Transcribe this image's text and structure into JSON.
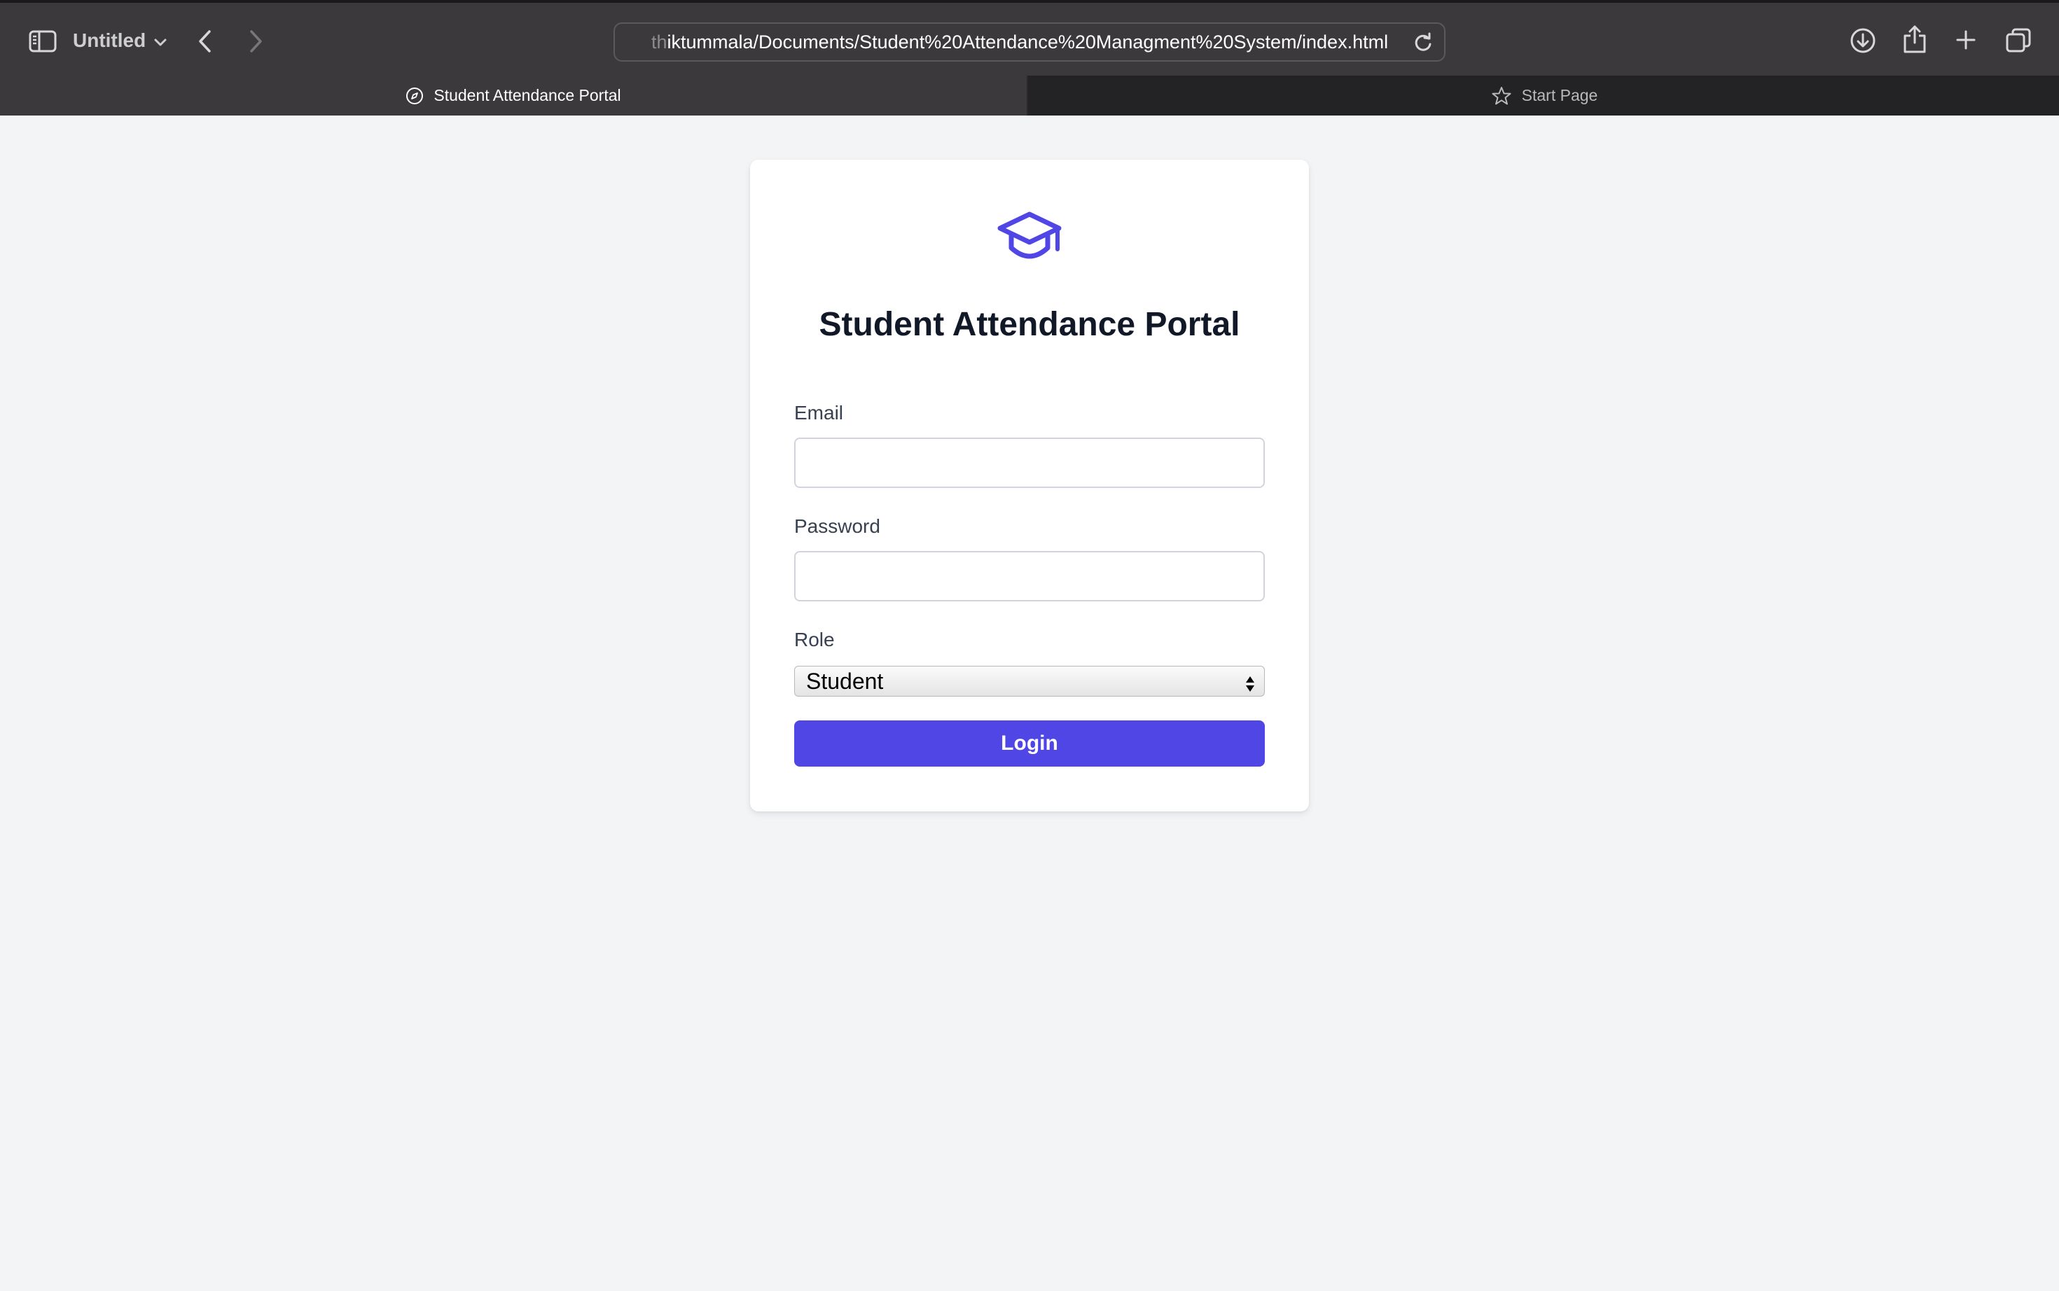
{
  "browser": {
    "window_title": "Untitled",
    "url_prefix_faded": "th",
    "url_main": "iktummala/Documents/Student%20Attendance%20Managment%20System/index.html",
    "tabs": [
      {
        "label": "Student Attendance Portal",
        "icon": "compass-icon",
        "active": true
      },
      {
        "label": "Start Page",
        "icon": "star-icon",
        "active": false
      }
    ],
    "toolbar_icons": [
      "sidebar-icon",
      "chevron-down-icon",
      "back-icon",
      "forward-icon",
      "reload-icon",
      "download-icon",
      "share-icon",
      "plus-icon",
      "tabs-overview-icon"
    ]
  },
  "login_card": {
    "icon": "graduation-cap-icon",
    "title": "Student Attendance Portal",
    "email_label": "Email",
    "email_value": "",
    "password_label": "Password",
    "password_value": "",
    "role_label": "Role",
    "role_selected": "Student",
    "login_label": "Login"
  },
  "colors": {
    "accent": "#4f46e5",
    "page_background": "#f3f4f6",
    "title_text": "#111827",
    "chrome_toolbar": "#3b393c",
    "chrome_tabbar": "#232224"
  }
}
